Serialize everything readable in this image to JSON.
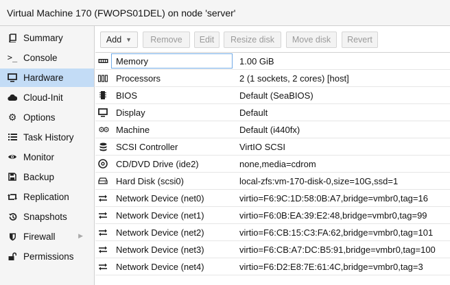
{
  "window": {
    "title": "Virtual Machine 170 (FWOPS01DEL) on node 'server'"
  },
  "sidebar": {
    "items": [
      {
        "label": "Summary",
        "icon": "book-icon"
      },
      {
        "label": "Console",
        "icon": "terminal-icon"
      },
      {
        "label": "Hardware",
        "icon": "monitor-icon",
        "active": true
      },
      {
        "label": "Cloud-Init",
        "icon": "cloud-icon"
      },
      {
        "label": "Options",
        "icon": "gear-icon"
      },
      {
        "label": "Task History",
        "icon": "list-icon"
      },
      {
        "label": "Monitor",
        "icon": "eye-icon"
      },
      {
        "label": "Backup",
        "icon": "floppy-icon"
      },
      {
        "label": "Replication",
        "icon": "retweet-icon"
      },
      {
        "label": "Snapshots",
        "icon": "history-icon"
      },
      {
        "label": "Firewall",
        "icon": "shield-icon",
        "has_submenu": true
      },
      {
        "label": "Permissions",
        "icon": "unlock-icon"
      }
    ]
  },
  "toolbar": {
    "add": "Add",
    "remove": "Remove",
    "edit": "Edit",
    "resize": "Resize disk",
    "move": "Move disk",
    "revert": "Revert"
  },
  "hardware": {
    "rows": [
      {
        "label": "Memory",
        "value": "1.00 GiB",
        "icon": "memory-icon"
      },
      {
        "label": "Processors",
        "value": "2 (1 sockets, 2 cores) [host]",
        "icon": "cpu-icon"
      },
      {
        "label": "BIOS",
        "value": "Default (SeaBIOS)",
        "icon": "microchip-icon"
      },
      {
        "label": "Display",
        "value": "Default",
        "icon": "desktop-icon"
      },
      {
        "label": "Machine",
        "value": "Default (i440fx)",
        "icon": "cogs-icon"
      },
      {
        "label": "SCSI Controller",
        "value": "VirtIO SCSI",
        "icon": "database-icon"
      },
      {
        "label": "CD/DVD Drive (ide2)",
        "value": "none,media=cdrom",
        "icon": "cdrom-icon"
      },
      {
        "label": "Hard Disk (scsi0)",
        "value": "local-zfs:vm-170-disk-0,size=10G,ssd=1",
        "icon": "hdd-icon"
      },
      {
        "label": "Network Device (net0)",
        "value": "virtio=F6:9C:1D:58:0B:A7,bridge=vmbr0,tag=16",
        "icon": "exchange-icon"
      },
      {
        "label": "Network Device (net1)",
        "value": "virtio=F6:0B:EA:39:E2:48,bridge=vmbr0,tag=99",
        "icon": "exchange-icon"
      },
      {
        "label": "Network Device (net2)",
        "value": "virtio=F6:CB:15:C3:FA:62,bridge=vmbr0,tag=101",
        "icon": "exchange-icon"
      },
      {
        "label": "Network Device (net3)",
        "value": "virtio=F6:CB:A7:DC:B5:91,bridge=vmbr0,tag=100",
        "icon": "exchange-icon"
      },
      {
        "label": "Network Device (net4)",
        "value": "virtio=F6:D2:E8:7E:61:4C,bridge=vmbr0,tag=3",
        "icon": "exchange-icon"
      }
    ]
  }
}
